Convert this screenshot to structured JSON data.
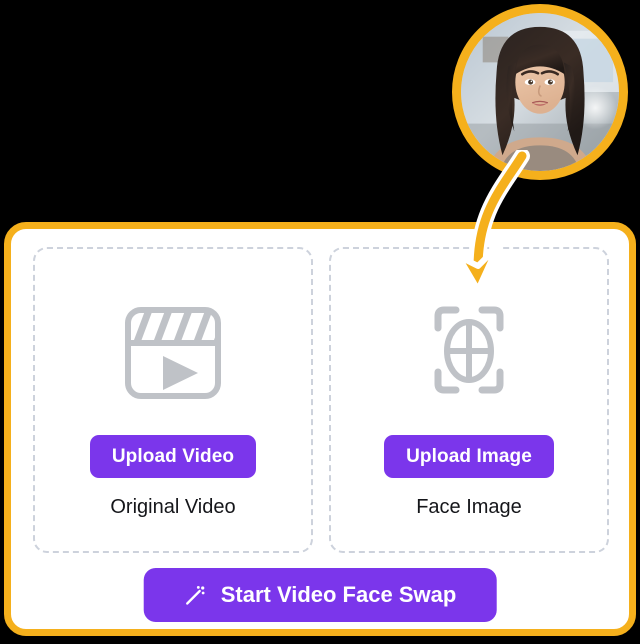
{
  "theme": {
    "background": "#000000",
    "card_background": "#ffffff",
    "accent_amber": "#F5B01C",
    "accent_purple": "#7B36EB",
    "dashed_border": "#CDD2DC",
    "icon_gray": "#BFC2C7",
    "caption_text": "#15161A"
  },
  "card": {
    "panels": [
      {
        "id": "original-video",
        "icon": "clapperboard-play-icon",
        "button_label": "Upload Video",
        "caption": "Original Video"
      },
      {
        "id": "face-image",
        "icon": "face-scan-frame-icon",
        "button_label": "Upload Image",
        "caption": "Face Image"
      }
    ],
    "cta": {
      "icon": "magic-wand-icon",
      "label": "Start Video Face Swap"
    }
  },
  "avatar": {
    "name": "source-face-avatar",
    "alt": "Portrait photo of a smiling woman with long dark hair",
    "ring_color": "#F5B01C"
  },
  "arrow": {
    "name": "avatar-to-face-arrow",
    "color": "#F5B01C",
    "outline": "#ffffff"
  }
}
